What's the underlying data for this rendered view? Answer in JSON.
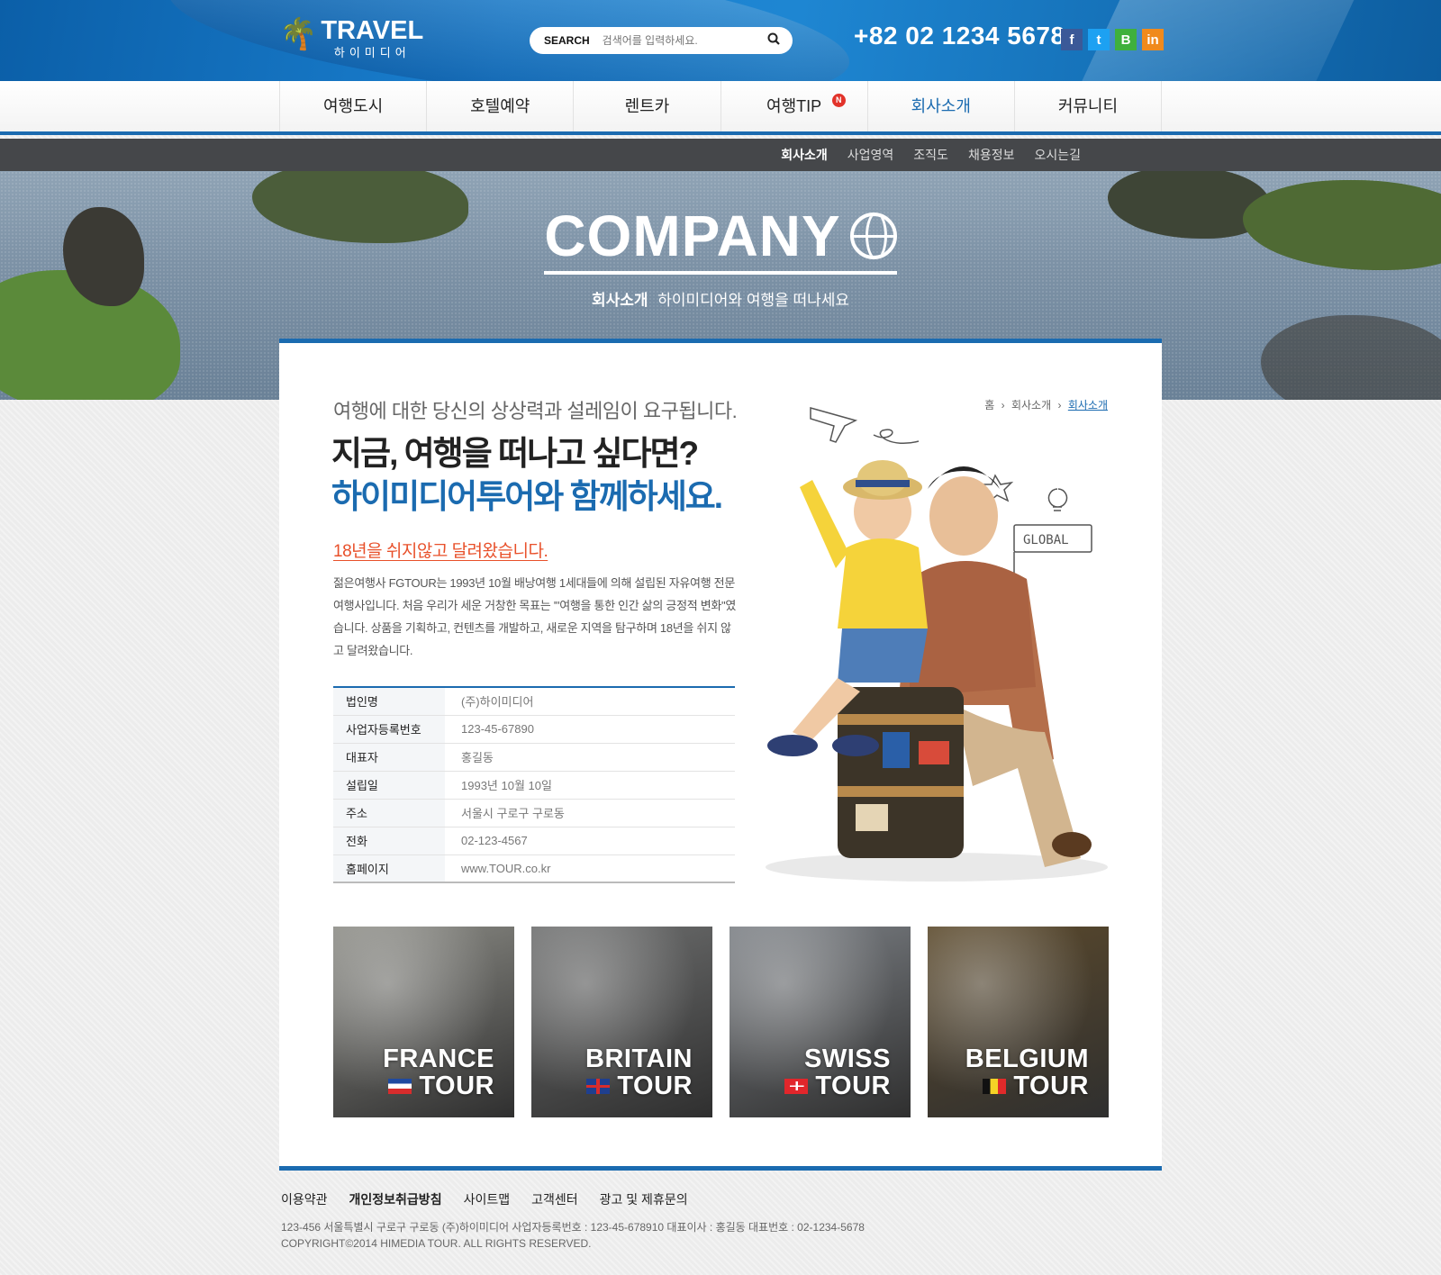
{
  "header": {
    "logo_main": "TRAVEL",
    "logo_sub": "하이미디어",
    "search_label": "SEARCH",
    "search_placeholder": "검색어를 입력하세요.",
    "phone": "+82 02 1234 5678",
    "sns": [
      {
        "label": "f",
        "color": "#3b5998",
        "icon": "facebook-icon"
      },
      {
        "label": "t",
        "color": "#1da1f2",
        "icon": "twitter-icon"
      },
      {
        "label": "B",
        "color": "#3fb03c",
        "icon": "blog-icon"
      },
      {
        "label": "in",
        "color": "#f08a1c",
        "icon": "linkedin-icon"
      }
    ]
  },
  "gnb": {
    "items": [
      {
        "label": "여행도시"
      },
      {
        "label": "호텔예약"
      },
      {
        "label": "렌트카"
      },
      {
        "label": "여행TIP",
        "badge": "N"
      },
      {
        "label": "회사소개",
        "active": true
      },
      {
        "label": "커뮤니티"
      }
    ]
  },
  "subnav": {
    "items": [
      "회사소개",
      "사업영역",
      "조직도",
      "채용정보",
      "오시는길"
    ]
  },
  "hero": {
    "title": "COMPANY",
    "sub_bold": "회사소개",
    "sub": "하이미디어와 여행을 떠나세요"
  },
  "breadcrumb": {
    "home": "홈",
    "parent": "회사소개",
    "current": "회사소개"
  },
  "intro": {
    "lead1": "여행에 대한 당신의 상상력과 설레임이 요구됩니다.",
    "lead2": "지금, 여행을 떠나고 싶다면?",
    "lead3": "하이미디어투어와 함께하세요.",
    "highlight": "18년을 쉬지않고 달려왔습니다.",
    "description": "젊은여행사 FGTOUR는 1993년 10월 배낭여행 1세대들에 의해 설립된 자유여행 전문 여행사입니다. 처음 우리가 세운 거창한 목표는 '\"여행을 통한 인간 삶의 긍정적 변화\"였습니다. 상품을 기획하고, 컨텐츠를 개발하고, 새로운 지역을 탐구하며 18년을 쉬지 않고 달려왔습니다."
  },
  "company_info": [
    {
      "key": "법인명",
      "value": "(주)하이미디어"
    },
    {
      "key": "사업자등록번호",
      "value": "123-45-67890"
    },
    {
      "key": "대표자",
      "value": "홍길동"
    },
    {
      "key": "설립일",
      "value": "1993년 10월 10일"
    },
    {
      "key": "주소",
      "value": "서울시 구로구 구로동"
    },
    {
      "key": "전화",
      "value": "02-123-4567"
    },
    {
      "key": "홈페이지",
      "value": "www.TOUR.co.kr"
    }
  ],
  "illustration_label": "GLOBAL",
  "tours": [
    {
      "line1": "FRANCE",
      "line2": "TOUR",
      "flag": "france-flag-icon",
      "bg": "#8e8e88"
    },
    {
      "line1": "BRITAIN",
      "line2": "TOUR",
      "flag": "uk-flag-icon",
      "bg": "#6f7070"
    },
    {
      "line1": "SWISS",
      "line2": "TOUR",
      "flag": "swiss-flag-icon",
      "bg": "#7d8186"
    },
    {
      "line1": "BELGIUM",
      "line2": "TOUR",
      "flag": "belgium-flag-icon",
      "bg": "#5c4a2c"
    }
  ],
  "footer": {
    "links": [
      {
        "label": "이용약관"
      },
      {
        "label": "개인정보취급방침",
        "bold": true
      },
      {
        "label": "사이트맵"
      },
      {
        "label": "고객센터"
      },
      {
        "label": "광고 및 제휴문의"
      }
    ],
    "address": "123-456 서울특별시 구로구 구로동 (주)하이미디어  사업자등록번호 : 123-45-678910  대표이사 : 홍길동  대표번호 : 02-1234-5678",
    "copyright": "COPYRIGHT©2014 HIMEDIA TOUR. ALL RIGHTS RESERVED."
  },
  "colors": {
    "primary": "#1b6bb0",
    "accent": "#e8502a",
    "badge": "#e2332a"
  }
}
